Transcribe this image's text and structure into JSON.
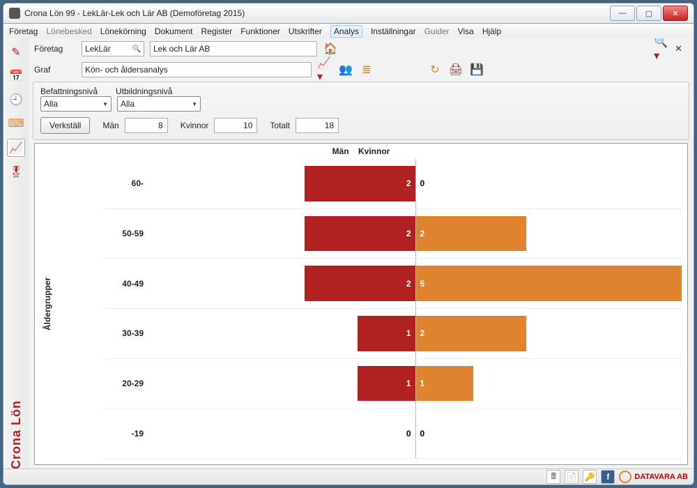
{
  "window_title": "Crona Lön 99 - LekLär-Lek och Lär AB (Demoföretag 2015)",
  "menu": {
    "items": [
      {
        "label": "Företag",
        "disabled": false
      },
      {
        "label": "Lönebesked",
        "disabled": true
      },
      {
        "label": "Lönekörning",
        "disabled": false
      },
      {
        "label": "Dokument",
        "disabled": false
      },
      {
        "label": "Register",
        "disabled": false
      },
      {
        "label": "Funktioner",
        "disabled": false
      },
      {
        "label": "Utskrifter",
        "disabled": false
      },
      {
        "label": "Analys",
        "disabled": false,
        "active": true
      },
      {
        "label": "Inställningar",
        "disabled": false
      },
      {
        "label": "Guider",
        "disabled": true
      },
      {
        "label": "Visa",
        "disabled": false
      },
      {
        "label": "Hjälp",
        "disabled": false
      }
    ]
  },
  "sidebar_brand": "Crona Lön",
  "toolbar": {
    "company_label": "Företag",
    "company_code": "LekLär",
    "company_name": "Lek och Lär AB",
    "graph_label": "Graf",
    "graph_value": "Kön- och åldersanalys"
  },
  "filters": {
    "position_label": "Befattningsnivå",
    "education_label": "Utbildningsnivå",
    "all_label_1": "Alla",
    "all_label_2": "Alla",
    "execute_label": "Verkställ",
    "men_label": "Män",
    "men_count": "8",
    "women_label": "Kvinnor",
    "women_count": "10",
    "total_label": "Totalt",
    "total_count": "18"
  },
  "chart_header": {
    "men": "Män",
    "women": "Kvinnor",
    "ylabel": "Åldergrupper"
  },
  "chart_data": {
    "type": "bar",
    "orientation": "horizontal-diverging",
    "title": "",
    "xlabel": "",
    "ylabel": "Åldergrupper",
    "categories": [
      "60-",
      "50-59",
      "40-49",
      "30-39",
      "20-29",
      "-19"
    ],
    "series": [
      {
        "name": "Män",
        "values": [
          2,
          2,
          2,
          1,
          1,
          0
        ]
      },
      {
        "name": "Kvinnor",
        "values": [
          0,
          2,
          5,
          2,
          1,
          0
        ]
      }
    ],
    "xlim_each_side": 5
  },
  "legend": {
    "men_color": "#b22121",
    "women_color": "#e0832f"
  },
  "statusbar_brand": "DATAVARA AB"
}
